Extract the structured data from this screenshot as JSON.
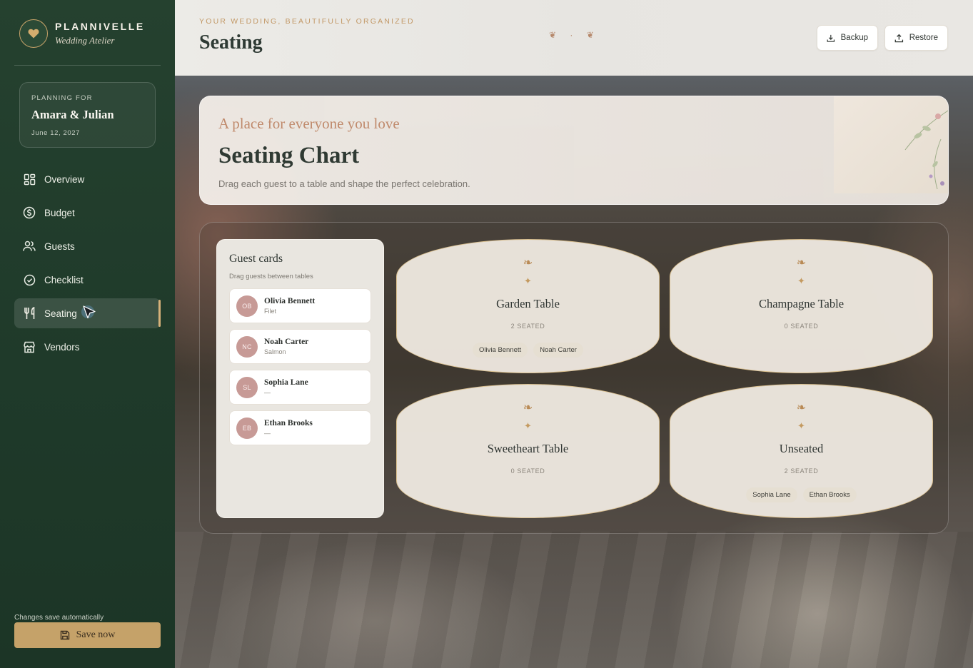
{
  "brand": {
    "name": "PLANNIVELLE",
    "subtitle": "Wedding Atelier"
  },
  "planning": {
    "label": "PLANNING FOR",
    "couple": "Amara & Julian",
    "date": "June 12, 2027"
  },
  "nav": {
    "items": [
      {
        "label": "Overview",
        "icon": "grid-icon"
      },
      {
        "label": "Budget",
        "icon": "dollar-icon"
      },
      {
        "label": "Guests",
        "icon": "users-icon"
      },
      {
        "label": "Checklist",
        "icon": "check-circle-icon"
      },
      {
        "label": "Seating",
        "icon": "utensils-icon",
        "active": true
      },
      {
        "label": "Vendors",
        "icon": "store-icon"
      }
    ]
  },
  "footer": {
    "autosave_text": "Changes save automatically",
    "save_label": "Save now"
  },
  "header": {
    "kicker": "YOUR WEDDING, BEAUTIFULLY ORGANIZED",
    "title": "Seating",
    "ornament": "❦ · ❦",
    "backup_label": "Backup",
    "restore_label": "Restore"
  },
  "hero": {
    "tagline": "A place for everyone you love",
    "title": "Seating Chart",
    "description": "Drag each guest to a table and shape the perfect celebration."
  },
  "guest_panel": {
    "title": "Guest cards",
    "subtitle": "Drag guests between tables",
    "guests": [
      {
        "initials": "OB",
        "name": "Olivia Bennett",
        "meal": "Filet"
      },
      {
        "initials": "NC",
        "name": "Noah Carter",
        "meal": "Salmon"
      },
      {
        "initials": "SL",
        "name": "Sophia Lane",
        "meal": "—"
      },
      {
        "initials": "EB",
        "name": "Ethan Brooks",
        "meal": "—"
      }
    ]
  },
  "tables": {
    "ornament_top": "❧",
    "ornament_star": "✦",
    "list": [
      {
        "name": "Garden Table",
        "count": "2 SEATED",
        "guests": [
          "Olivia Bennett",
          "Noah Carter"
        ]
      },
      {
        "name": "Champagne Table",
        "count": "0 SEATED",
        "guests": []
      },
      {
        "name": "Sweetheart Table",
        "count": "0 SEATED",
        "guests": []
      },
      {
        "name": "Unseated",
        "count": "2 SEATED",
        "guests": [
          "Sophia Lane",
          "Ethan Brooks"
        ]
      }
    ]
  },
  "colors": {
    "sidebar_green": "#1f3a2a",
    "accent_gold": "#c5a269",
    "avatar_rose": "#c79a96",
    "table_border": "#d9bf8f"
  }
}
